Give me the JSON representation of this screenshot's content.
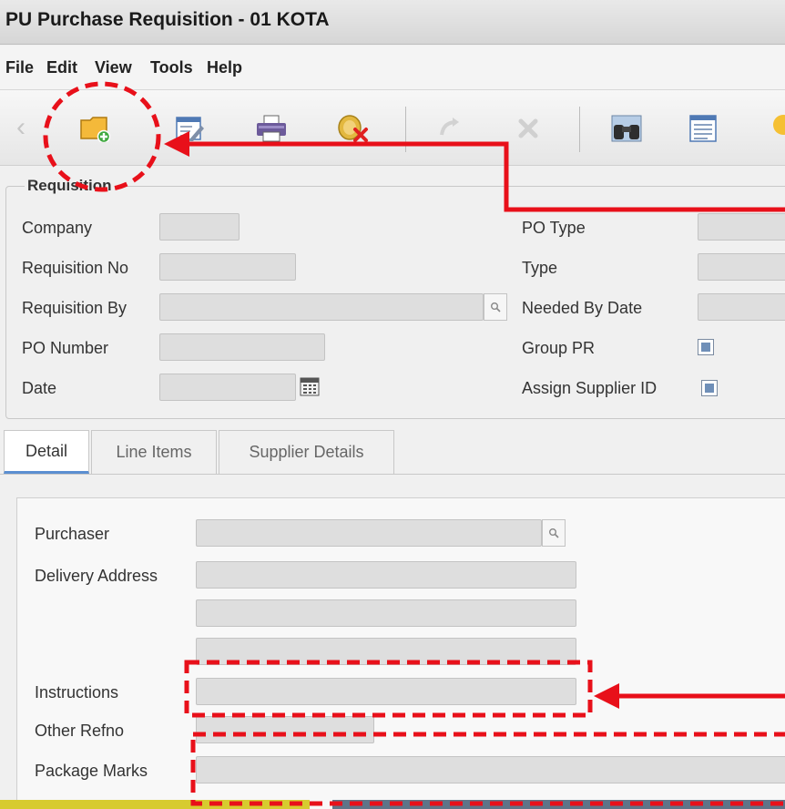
{
  "window": {
    "title": "PU Purchase Requisition - 01 KOTA"
  },
  "menu": [
    "File",
    "Edit",
    "View",
    "Tools",
    "Help"
  ],
  "toolbar": {
    "buttons": [
      {
        "name": "new-record-button",
        "icon": "folder-add-icon"
      },
      {
        "name": "edit-button",
        "icon": "edit-form-icon"
      },
      {
        "name": "print-button",
        "icon": "printer-icon"
      },
      {
        "name": "void-button",
        "icon": "coin-cancel-icon"
      },
      {
        "name": "refresh-button",
        "icon": "refresh-icon"
      },
      {
        "name": "delete-button",
        "icon": "delete-x-icon"
      },
      {
        "name": "find-button",
        "icon": "binoculars-icon"
      },
      {
        "name": "report-button",
        "icon": "document-icon"
      },
      {
        "name": "help-button",
        "icon": "bulb-icon"
      }
    ]
  },
  "requisition": {
    "legend": "Requisition",
    "company_label": "Company",
    "requisition_no_label": "Requisition No",
    "requisition_by_label": "Requisition By",
    "po_number_label": "PO Number",
    "date_label": "Date",
    "po_type_label": "PO Type",
    "type_label": "Type",
    "needed_by_date_label": "Needed By Date",
    "group_pr_label": "Group PR",
    "assign_supplier_id_label": "Assign Supplier ID"
  },
  "tabs": [
    "Detail",
    "Line Items",
    "Supplier Details"
  ],
  "detail": {
    "purchaser_label": "Purchaser",
    "delivery_address_label": "Delivery Address",
    "instructions_label": "Instructions",
    "other_refno_label": "Other Refno",
    "package_marks_label": "Package Marks"
  },
  "colors": {
    "annotation": "#e8101a",
    "tab_accent": "#5b8fd1"
  }
}
